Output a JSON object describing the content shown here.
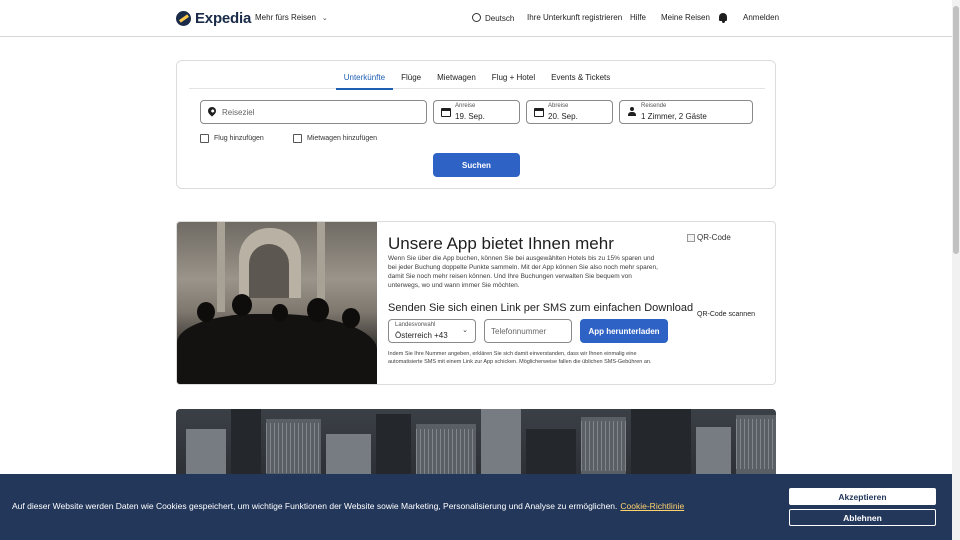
{
  "header": {
    "brand": "Expedia",
    "more_trips": "Mehr fürs Reisen",
    "language": "Deutsch",
    "register_property": "Ihre Unterkunft registrieren",
    "help": "Hilfe",
    "my_trips": "Meine Reisen",
    "sign_in": "Anmelden"
  },
  "search": {
    "tabs": [
      "Unterkünfte",
      "Flüge",
      "Mietwagen",
      "Flug + Hotel",
      "Events & Tickets"
    ],
    "active_tab": "Unterkünfte",
    "destination_placeholder": "Reiseziel",
    "checkin_label": "Anreise",
    "checkin_value": "19. Sep.",
    "checkout_label": "Abreise",
    "checkout_value": "20. Sep.",
    "travelers_label": "Reisende",
    "travelers_value": "1 Zimmer, 2 Gäste",
    "add_flight": "Flug hinzufügen",
    "add_car": "Mietwagen hinzufügen",
    "submit": "Suchen"
  },
  "app_promo": {
    "title": "Unsere App bietet Ihnen mehr",
    "description": "Wenn Sie über die App buchen, können Sie bei ausgewählten Hotels bis zu 15% sparen und bei jeder Buchung doppelte Punkte sammeln. Mit der App können Sie also noch mehr sparen, damit Sie noch mehr reisen können. Und Ihre Buchungen verwalten Sie bequem von unterwegs, wo und wann immer Sie möchten.",
    "sms_heading": "Senden Sie sich einen Link per SMS zum einfachen Download",
    "country_label": "Landesvorwahl",
    "country_value": "Österreich +43",
    "phone_placeholder": "Telefonnummer",
    "download_button": "App herunterladen",
    "legal": "Indem Sie Ihre Nummer angeben, erklären Sie sich damit einverstanden, dass wir Ihnen einmalig eine automatisierte SMS mit einem Link zur App schicken. Möglicherweise fallen die üblichen SMS-Gebühren an.",
    "qr_alt": "QR-Code",
    "qr_scan": "QR-Code scannen"
  },
  "cookie": {
    "text": "Auf dieser Website werden Daten wie Cookies gespeichert, um wichtige Funktionen der Website sowie Marketing, Personalisierung und Analyse zu ermöglichen.",
    "link": "Cookie-Richtlinie",
    "accept": "Akzeptieren",
    "decline": "Ablehnen"
  },
  "colors": {
    "brand_navy": "#1a2b49",
    "primary_blue": "#2f62c5",
    "cookie_bg": "#23375b"
  }
}
